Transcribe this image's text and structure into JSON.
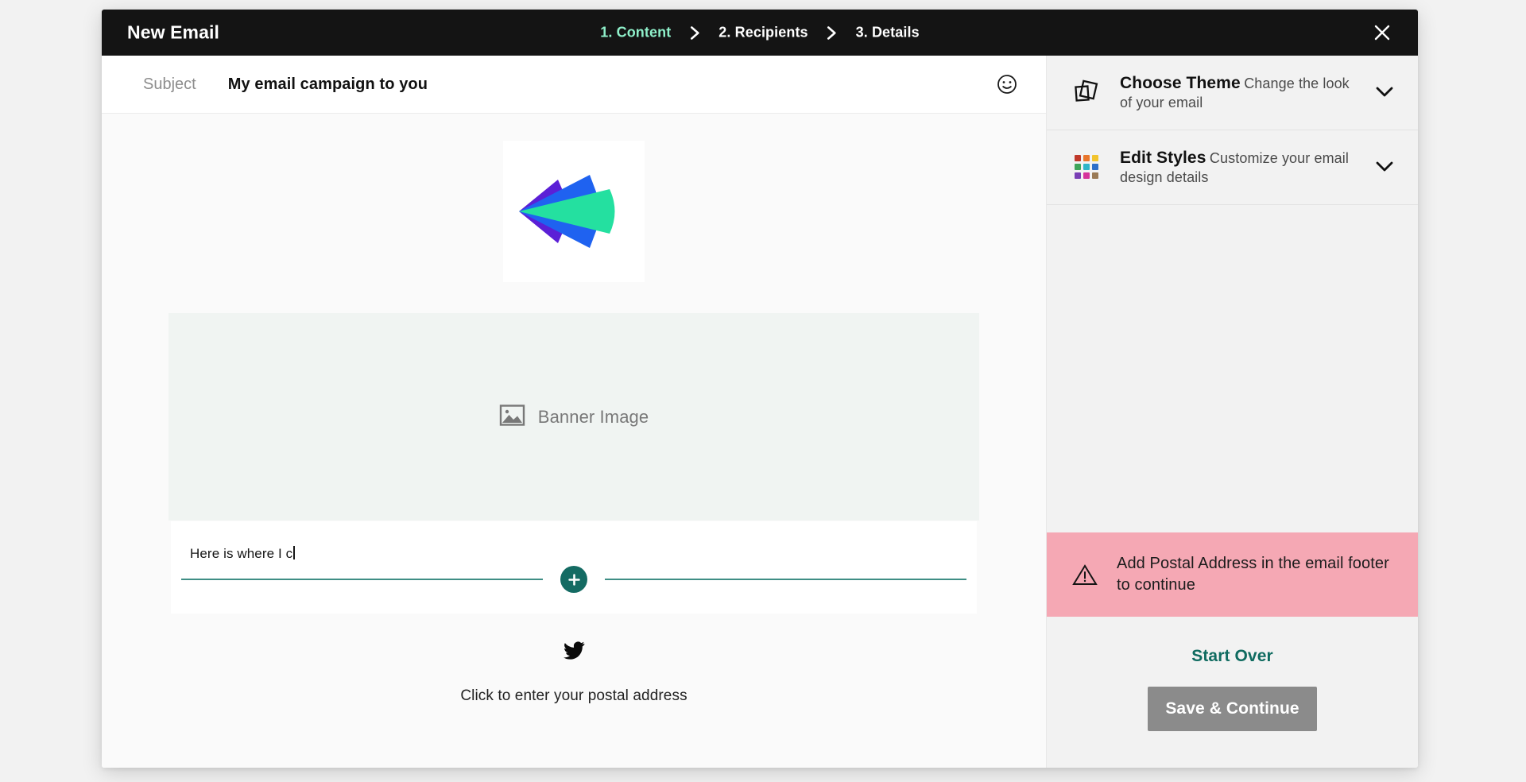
{
  "header": {
    "title": "New Email",
    "close_icon": "close-icon",
    "steps": [
      {
        "label": "1. Content",
        "active": true
      },
      {
        "label": "2. Recipients",
        "active": false
      },
      {
        "label": "3. Details",
        "active": false
      }
    ],
    "separator_icon": "chevron-right-icon",
    "bg": "#141414",
    "active_step_color": "#8ff0ca"
  },
  "subject": {
    "label": "Subject",
    "value": "My email campaign to you",
    "placeholder": "Subject",
    "emoji_icon": "smiley-face-icon"
  },
  "canvas": {
    "logo_icon": "brand-fan-logo",
    "logo_colors": [
      "#5b1fd6",
      "#1f62f0",
      "#24e0a0"
    ],
    "banner": {
      "icon": "image-placeholder-icon",
      "label": "Banner Image",
      "bg": "#f0f4f2"
    },
    "textblock": {
      "value": "Here is where I c",
      "add_icon": "plus-icon",
      "divider_color": "#3f8e85",
      "add_button_color": "#146b63"
    },
    "social": {
      "icon": "twitter-icon"
    },
    "postal": {
      "label": "Click to enter your postal address"
    }
  },
  "sidebar": {
    "panels": [
      {
        "title": "Choose Theme",
        "subtitle": "Change the look of your email",
        "icon": "theme-cards-icon",
        "chevron": "chevron-down-icon"
      },
      {
        "title": "Edit Styles",
        "subtitle": "Customize your email design details",
        "icon": "color-palette-grid-icon",
        "chevron": "chevron-down-icon"
      }
    ],
    "palette_colors": [
      "#c0392b",
      "#e8762c",
      "#f2c42e",
      "#3fa55a",
      "#2fb5c8",
      "#2d6fc9",
      "#7a3fb5",
      "#d6339b",
      "#9a7a55"
    ],
    "alert": {
      "icon": "warning-triangle-icon",
      "text": "Add Postal Address in the email footer to continue",
      "bg": "#f5a8b4"
    },
    "actions": {
      "start_over_label": "Start Over",
      "start_over_color": "#0f6b60",
      "save_label": "Save & Continue",
      "save_bg": "#8b8b8b",
      "save_enabled": false
    }
  }
}
